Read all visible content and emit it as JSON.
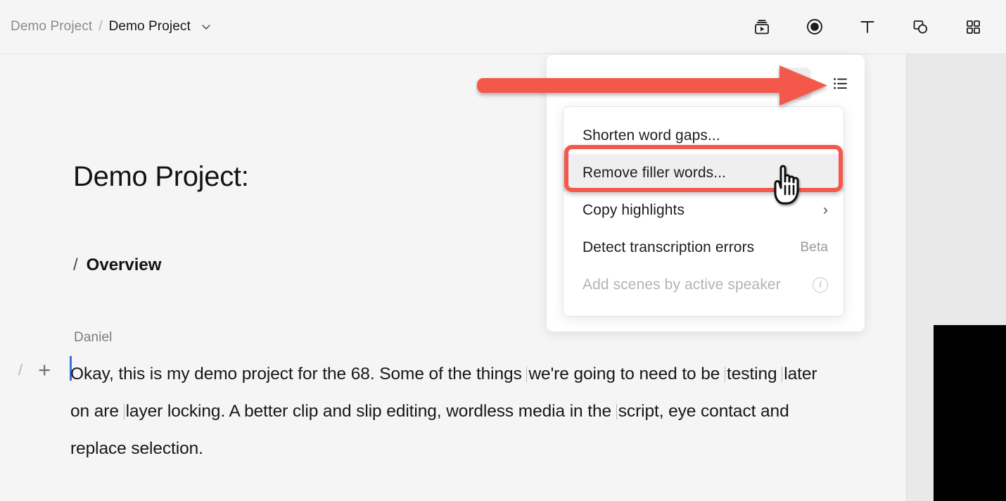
{
  "header": {
    "breadcrumb": {
      "parent": "Demo Project",
      "separator": "/",
      "current": "Demo Project",
      "chevron_icon": "chevron-down-icon"
    },
    "tools": [
      {
        "name": "media-library-icon",
        "label": "Media library"
      },
      {
        "name": "record-icon",
        "label": "Record"
      },
      {
        "name": "text-icon",
        "label": "Text"
      },
      {
        "name": "shapes-icon",
        "label": "Shapes"
      },
      {
        "name": "apps-grid-icon",
        "label": "Apps"
      }
    ]
  },
  "doc_toolbar": {
    "pen_icon": "quill-pen-icon",
    "chevron_icon": "chevron-down-icon"
  },
  "document": {
    "title": "Demo Project:",
    "section": {
      "marker": "/",
      "heading": "Overview"
    },
    "speaker": "Daniel",
    "gutter": {
      "slash": "/",
      "plus": "+"
    },
    "paragraph_segments": [
      {
        "text": "Okay, this is my demo project for the 68. Some of the things ",
        "tick": false
      },
      {
        "text": "we're going to need to be ",
        "tick": true
      },
      {
        "text": "testing ",
        "tick": true
      },
      {
        "text": "later on are ",
        "tick": true
      },
      {
        "text": "layer locking. A better clip and slip editing, wordless media in the ",
        "tick": true
      },
      {
        "text": "script, eye contact and replace selection.",
        "tick": true
      }
    ],
    "paragraph_full": "Okay, this is my demo project for the 68. Some of the things we're going to need to be testing later on are layer locking. A better clip and slip editing, wordless media in the script, eye contact and replace selection."
  },
  "ai_panel": {
    "sparkle_button": {
      "name": "ai-sparkle-icon",
      "label": "AI tools",
      "active": true
    },
    "list_button": {
      "name": "list-icon",
      "label": "List view",
      "active": false
    },
    "menu": {
      "items": [
        {
          "label": "Shorten word gaps...",
          "state": "normal",
          "badge": "",
          "submenu": false
        },
        {
          "label": "Remove filler words...",
          "state": "selected",
          "badge": "",
          "submenu": false
        },
        {
          "label": "Copy highlights",
          "state": "normal",
          "badge": "",
          "submenu": true,
          "chevron": "›"
        },
        {
          "label": "Detect transcription errors",
          "state": "normal",
          "badge": "Beta",
          "submenu": false
        },
        {
          "label": "Add scenes by active speaker",
          "state": "disabled",
          "badge": "",
          "submenu": false,
          "info": "i"
        }
      ]
    }
  },
  "annotations": {
    "arrow": {
      "name": "pointer-arrow",
      "color": "#F4584C"
    },
    "highlight_box": {
      "name": "highlight-box",
      "color": "#F4584C",
      "target": "Remove filler words..."
    },
    "cursor": {
      "name": "hand-cursor",
      "color": "#FFFFFF"
    }
  },
  "right_rail": {
    "video_preview_label": ""
  }
}
